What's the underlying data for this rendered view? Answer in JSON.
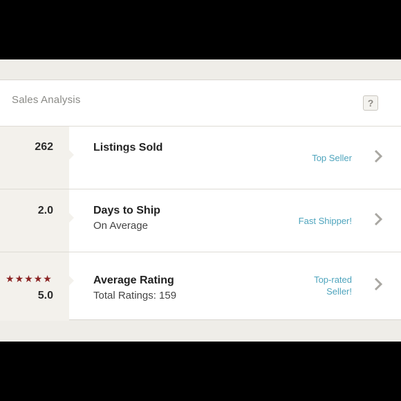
{
  "header": {
    "title": "Sales Analysis",
    "help_glyph": "?"
  },
  "rows": [
    {
      "value": "262",
      "title": "Listings Sold",
      "subtitle": "",
      "badge": "Top Seller"
    },
    {
      "value": "2.0",
      "title": "Days to Ship",
      "subtitle": "On Average",
      "badge": "Fast Shipper!"
    },
    {
      "value": "5.0",
      "title": "Average Rating",
      "subtitle": "Total Ratings: 159",
      "badge_line1": "Top-rated",
      "badge_line2": "Seller!",
      "stars": 5
    }
  ],
  "icons": {
    "help": "question-mark-icon",
    "chevron": "chevron-right-icon",
    "star": "star-icon"
  },
  "colors": {
    "accent_link": "#4ea4bd",
    "star": "#8b2424",
    "panel": "#f3f1ec",
    "background": "#efede8"
  }
}
